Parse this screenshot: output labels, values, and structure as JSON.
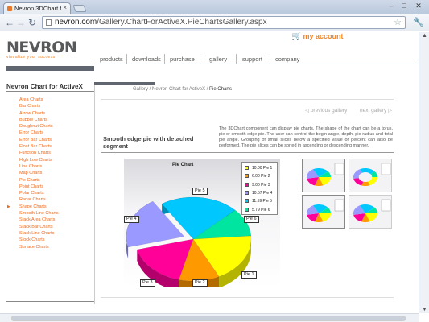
{
  "browser": {
    "tab_title": "Nevron 3DChart fo",
    "tab_close": "×",
    "url_host": "nevron.com",
    "url_path": "/Gallery.ChartForActiveX.PieChartsGallery.aspx",
    "win_min": "–",
    "win_max": "□",
    "win_close": "✕"
  },
  "header": {
    "logo": "NEVRON",
    "tagline": "visualize your success",
    "account_label": "my account"
  },
  "nav": {
    "items": [
      "products",
      "downloads",
      "purchase",
      "gallery",
      "support",
      "company"
    ]
  },
  "sidebar": {
    "title": "Nevron Chart for ActiveX",
    "items": [
      "Area Charts",
      "Bar Charts",
      "Arrow Charts",
      "Bubble Charts",
      "Doughnut Charts",
      "Error Charts",
      "Error Bar Charts",
      "Float Bar Charts",
      "Function Charts",
      "High Low Charts",
      "Line Charts",
      "Map Charts",
      "Pie Charts",
      "Point Charts",
      "Polar Charts",
      "Radar Charts",
      "Shape Charts",
      "Smooth Line Charts",
      "Stack Area Charts",
      "Stack Bar Charts",
      "Stack Line Charts",
      "Stock Charts",
      "Surface Charts"
    ],
    "active_marker": "▶"
  },
  "content": {
    "breadcrumb_path": "Gallery / Nevron Chart for ActiveX / ",
    "breadcrumb_current": "Pie Charts",
    "prev_gallery": "previous gallery",
    "next_gallery": "next gallery",
    "heading": "Smooth edge pie with detached segment",
    "description": "The 3DChart component can display pie charts. The shape of the chart can be a torus, pie or smooth edge pie. The user can control the begin angle, depth, pie radius and total pie angle. Grouping of small slices below a specified value or percent can also be performed. The pie slices can be sorted in ascending or descending manner."
  },
  "chart_data": {
    "type": "pie",
    "title": "Pie Chart",
    "categories": [
      "Pie 1",
      "Pie 2",
      "Pie 3",
      "Pie 4",
      "Pie 5",
      "Pie 6"
    ],
    "values": [
      10.0,
      6.0,
      9.0,
      10.57,
      11.59,
      5.79
    ],
    "value_labels": [
      "10.00",
      "6.00",
      "9.00",
      "10.57",
      "11.59",
      "5.79"
    ],
    "colors": [
      "#ffff00",
      "#ff9900",
      "#ff0099",
      "#9999ff",
      "#00c8ff",
      "#00e6a0"
    ],
    "detached": "Pie 4",
    "legend": "top-right"
  },
  "thumbnails": [
    "pie",
    "torus",
    "pie-selected",
    "pie-small"
  ]
}
